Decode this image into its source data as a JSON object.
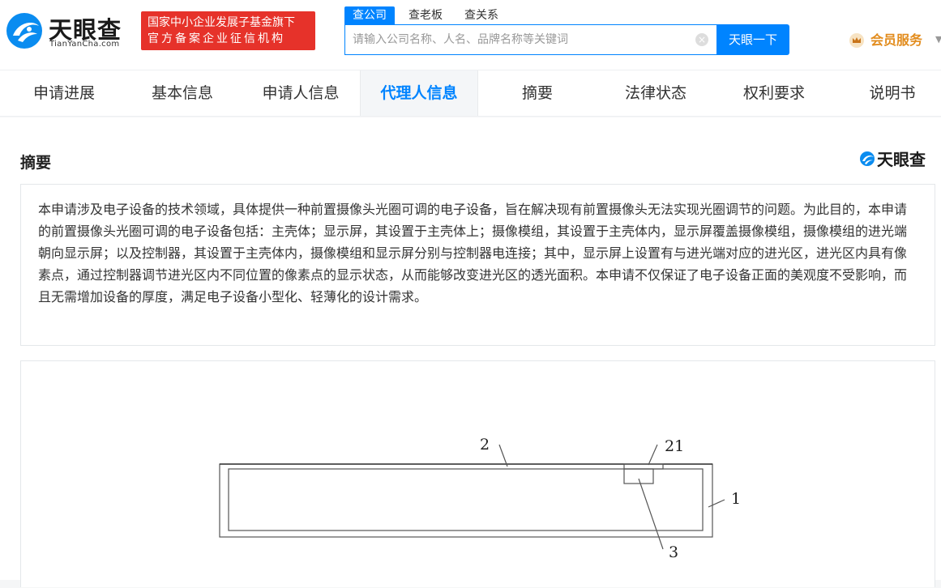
{
  "header": {
    "logo_cn": "天眼查",
    "logo_en": "TianYanCha.com",
    "badge_line1": "国家中小企业发展子基金旗下",
    "badge_line2": "官方备案企业征信机构",
    "search_tabs": [
      "查公司",
      "查老板",
      "查关系"
    ],
    "search_placeholder": "请输入公司名称、人名、品牌名称等关键词",
    "search_button": "天眼一下",
    "vip_label": "会员服务",
    "brand_color": "#0084ff"
  },
  "nav": {
    "tabs": [
      "申请进展",
      "基本信息",
      "申请人信息",
      "代理人信息",
      "摘要",
      "法律状态",
      "权利要求",
      "说明书"
    ],
    "active_index": 3
  },
  "abstract": {
    "title": "摘要",
    "watermark": "天眼查",
    "text": "本申请涉及电子设备的技术领域，具体提供一种前置摄像头光圈可调的电子设备，旨在解决现有前置摄像头无法实现光圈调节的问题。为此目的，本申请的前置摄像头光圈可调的电子设备包括：主壳体；显示屏，其设置于主壳体上；摄像模组，其设置于主壳体内，显示屏覆盖摄像模组，摄像模组的进光端朝向显示屏；以及控制器，其设置于主壳体内，摄像模组和显示屏分别与控制器电连接；其中，显示屏上设置有与进光端对应的进光区，进光区内具有像素点，通过控制器调节进光区内不同位置的像素点的显示状态，从而能够改变进光区的透光面积。本申请不仅保证了电子设备正面的美观度不受影响，而且无需增加设备的厚度，满足电子设备小型化、轻薄化的设计需求。"
  },
  "figure": {
    "labels": [
      "2",
      "21",
      "1",
      "3"
    ]
  }
}
